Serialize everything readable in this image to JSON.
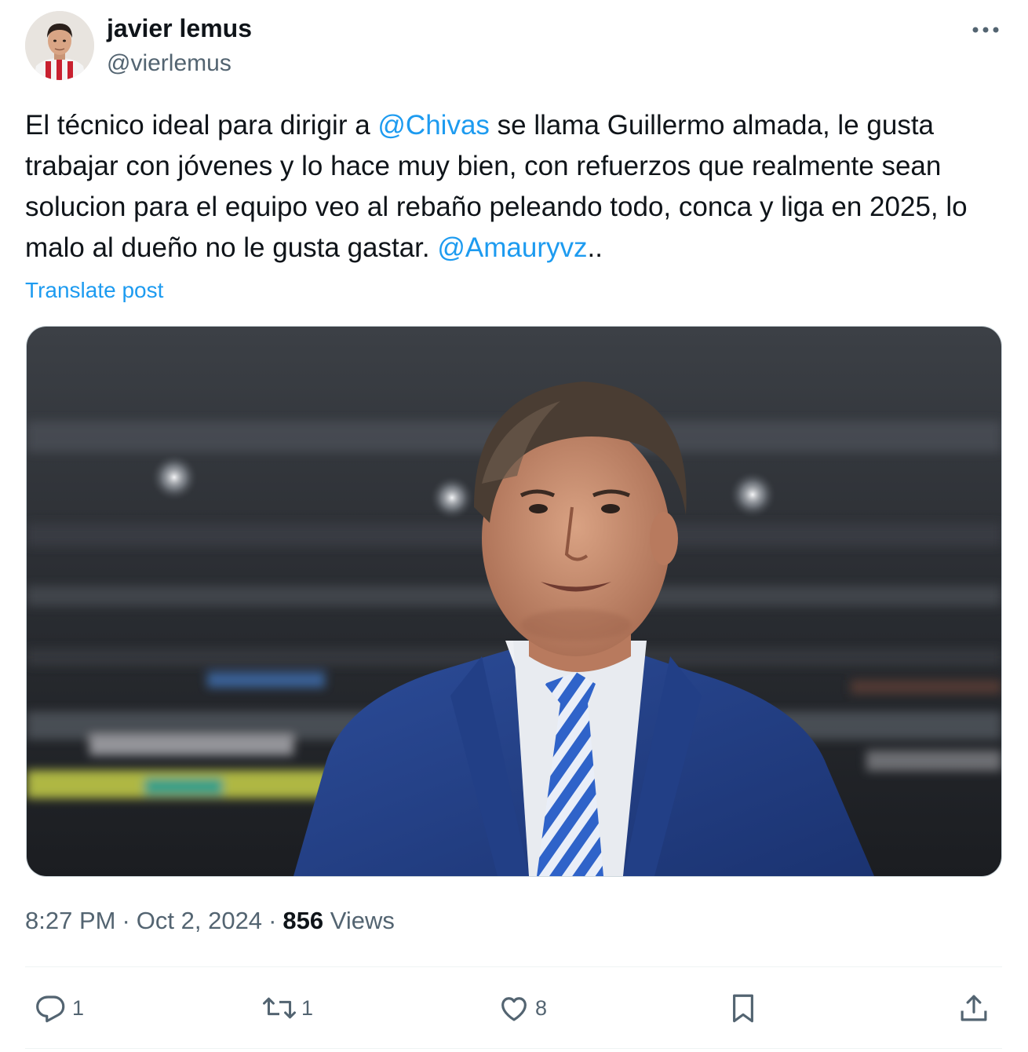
{
  "author": {
    "name": "javier lemus",
    "handle": "@vierlemus"
  },
  "icons": {
    "more": "more-horizontal-icon",
    "reply": "reply-icon",
    "repost": "repost-icon",
    "like": "like-icon",
    "bookmark": "bookmark-icon",
    "share": "share-icon"
  },
  "post": {
    "text_1": "El técnico ideal para dirigir a ",
    "mention_1": "@Chivas",
    "text_2": " se llama Guillermo almada, le gusta trabajar con jóvenes y lo hace muy bien, con refuerzos que realmente sean solucion para el equipo veo al rebaño peleando todo, conca y liga en 2025, lo malo al dueño no le gusta gastar. ",
    "mention_2": "@Amauryvz",
    "text_3": "..",
    "translate_label": "Translate post"
  },
  "meta": {
    "time": "8:27 PM",
    "separator": "·",
    "date": "Oct 2, 2024",
    "views_count": "856",
    "views_label": "Views"
  },
  "actions": {
    "replies": "1",
    "reposts": "1",
    "likes": "8"
  },
  "colors": {
    "accent": "#1d9bf0",
    "text_primary": "#0f1419",
    "text_secondary": "#536471",
    "divider": "#eff3f4"
  }
}
